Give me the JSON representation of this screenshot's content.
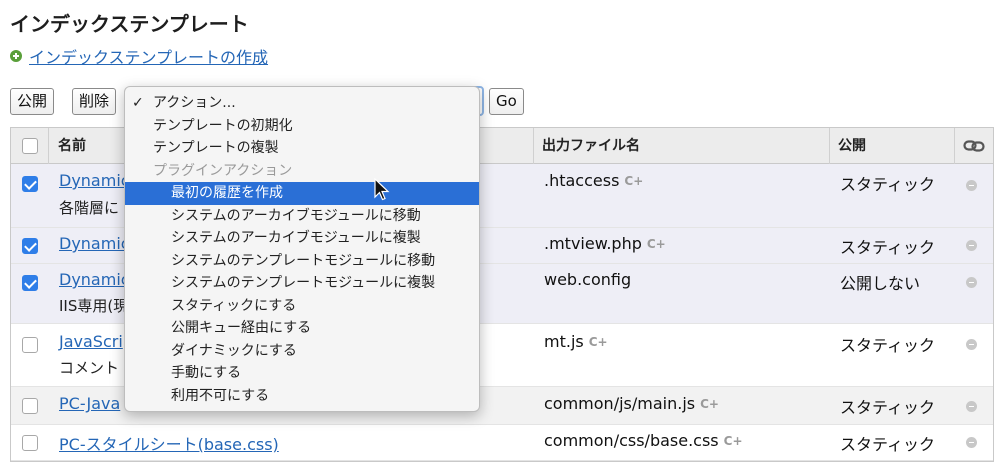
{
  "page_title": "インデックステンプレート",
  "create_link": "インデックステンプレートの作成",
  "toolbar": {
    "publish": "公開",
    "delete": "削除",
    "go": "Go"
  },
  "table": {
    "headers": {
      "name": "名前",
      "output": "出力ファイル名",
      "publish": "公開"
    },
    "rows": [
      {
        "name": "Dynamic",
        "desc": "各階層に",
        "output": ".htaccess",
        "publish": "スタティック",
        "checked": true
      },
      {
        "name": "Dynamic",
        "desc": "",
        "output": ".mtview.php",
        "publish": "スタティック",
        "checked": true
      },
      {
        "name": "Dynamic",
        "desc": "IIS専用(現",
        "output": "web.config",
        "publish": "公開しない",
        "checked": true
      },
      {
        "name": "JavaScri",
        "desc": "コメント",
        "output": "mt.js",
        "publish": "スタティック",
        "checked": false
      },
      {
        "name": "PC-Java",
        "desc": "",
        "output": "common/js/main.js",
        "publish": "スタティック",
        "checked": false
      },
      {
        "name": "PC-スタイルシート(base.css)",
        "desc": "",
        "output": "common/css/base.css",
        "publish": "スタティック",
        "checked": false
      }
    ]
  },
  "menu": {
    "check_glyph": "✓",
    "items": [
      {
        "label": "アクション...",
        "checked": true
      },
      {
        "label": "テンプレートの初期化"
      },
      {
        "label": "テンプレートの複製"
      },
      {
        "label": "プラグインアクション",
        "disabled": true
      },
      {
        "label": "最初の履歴を作成",
        "highlighted": true
      },
      {
        "label": "システムのアーカイブモジュールに移動"
      },
      {
        "label": "システムのアーカイブモジュールに複製"
      },
      {
        "label": "システムのテンプレートモジュールに移動"
      },
      {
        "label": "システムのテンプレートモジュールに複製"
      },
      {
        "label": "スタティックにする"
      },
      {
        "label": "公開キュー経由にする"
      },
      {
        "label": "ダイナミックにする"
      },
      {
        "label": "手動にする"
      },
      {
        "label": "利用不可にする"
      }
    ]
  },
  "icons": {
    "refresh": "refresh-icon",
    "link": "link-icon",
    "plus": "plus-circle-icon",
    "cursor": "mouse-cursor-icon"
  },
  "colors": {
    "link": "#2466b6",
    "highlight": "#2a6fd6",
    "checkbox": "#2f7ee8",
    "add_icon": "#5a9f3a"
  }
}
